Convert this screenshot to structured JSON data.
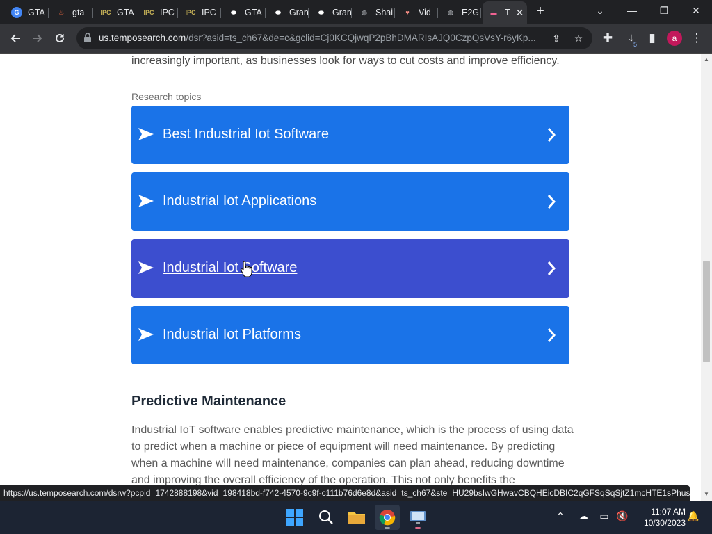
{
  "browser": {
    "tabs": [
      {
        "title": "GTA",
        "icon": "google-icon",
        "active": false
      },
      {
        "title": "gta",
        "icon": "flame-icon",
        "active": false
      },
      {
        "title": "GTA",
        "icon": "ipc-games-icon",
        "active": false
      },
      {
        "title": "IPC",
        "icon": "ipc-games-icon",
        "active": false
      },
      {
        "title": "IPC",
        "icon": "ipc-games-icon",
        "active": false
      },
      {
        "title": "GTA",
        "icon": "pill-icon",
        "active": false
      },
      {
        "title": "Gran",
        "icon": "pill-icon",
        "active": false
      },
      {
        "title": "Gran",
        "icon": "pill-icon",
        "active": false
      },
      {
        "title": "Shai",
        "icon": "globe-icon",
        "active": false
      },
      {
        "title": "Vid",
        "icon": "heart-icon",
        "active": false
      },
      {
        "title": "E2G",
        "icon": "globe-icon",
        "active": false
      },
      {
        "title": "T",
        "icon": "tempo-icon",
        "active": true
      }
    ],
    "new_tab_label": "+",
    "window_controls": {
      "minimize": "—",
      "restore": "❐",
      "close": "✕",
      "tab_search": "⌄"
    },
    "url_host": "us.temposearch.com",
    "url_path": "/dsr?asid=ts_ch67&de=c&gclid=Cj0KCQjwqP2pBhDMARIsAJQ0CzpQsVsY-r6yKp...",
    "profile_initial": "a",
    "download_badge": "5"
  },
  "page": {
    "intro_text": "increasingly important, as businesses look for ways to cut costs and improve efficiency.",
    "topics_label": "Research topics",
    "topics": [
      {
        "label": "Best Industrial Iot Software"
      },
      {
        "label": "Industrial Iot Applications"
      },
      {
        "label": "Industrial Iot Software"
      },
      {
        "label": "Industrial Iot Platforms"
      }
    ],
    "section_title": "Predictive Maintenance",
    "paragraph": "Industrial IoT software enables predictive maintenance, which is the process of using data to predict when a machine or piece of equipment will need maintenance. By predicting when a machine will need maintenance, companies can plan ahead, reducing downtime and improving the overall efficiency of the operation. This not only benefits the",
    "colors": {
      "topic_bg": "#1a73e8",
      "topic_hover_bg": "#3c4ecf"
    }
  },
  "status_url": "https://us.temposearch.com/dsrw?pcpid=1742888198&vid=198418bd-f742-4570-9c9f-c111b76d6e8d&asid=ts_ch67&ste=HU29bsIwGHwavCBQHEicDBIC2qGFSqSqSjtZ1mcHTE1sPhus...",
  "taskbar": {
    "time": "11:07 AM",
    "date": "10/30/2023"
  }
}
